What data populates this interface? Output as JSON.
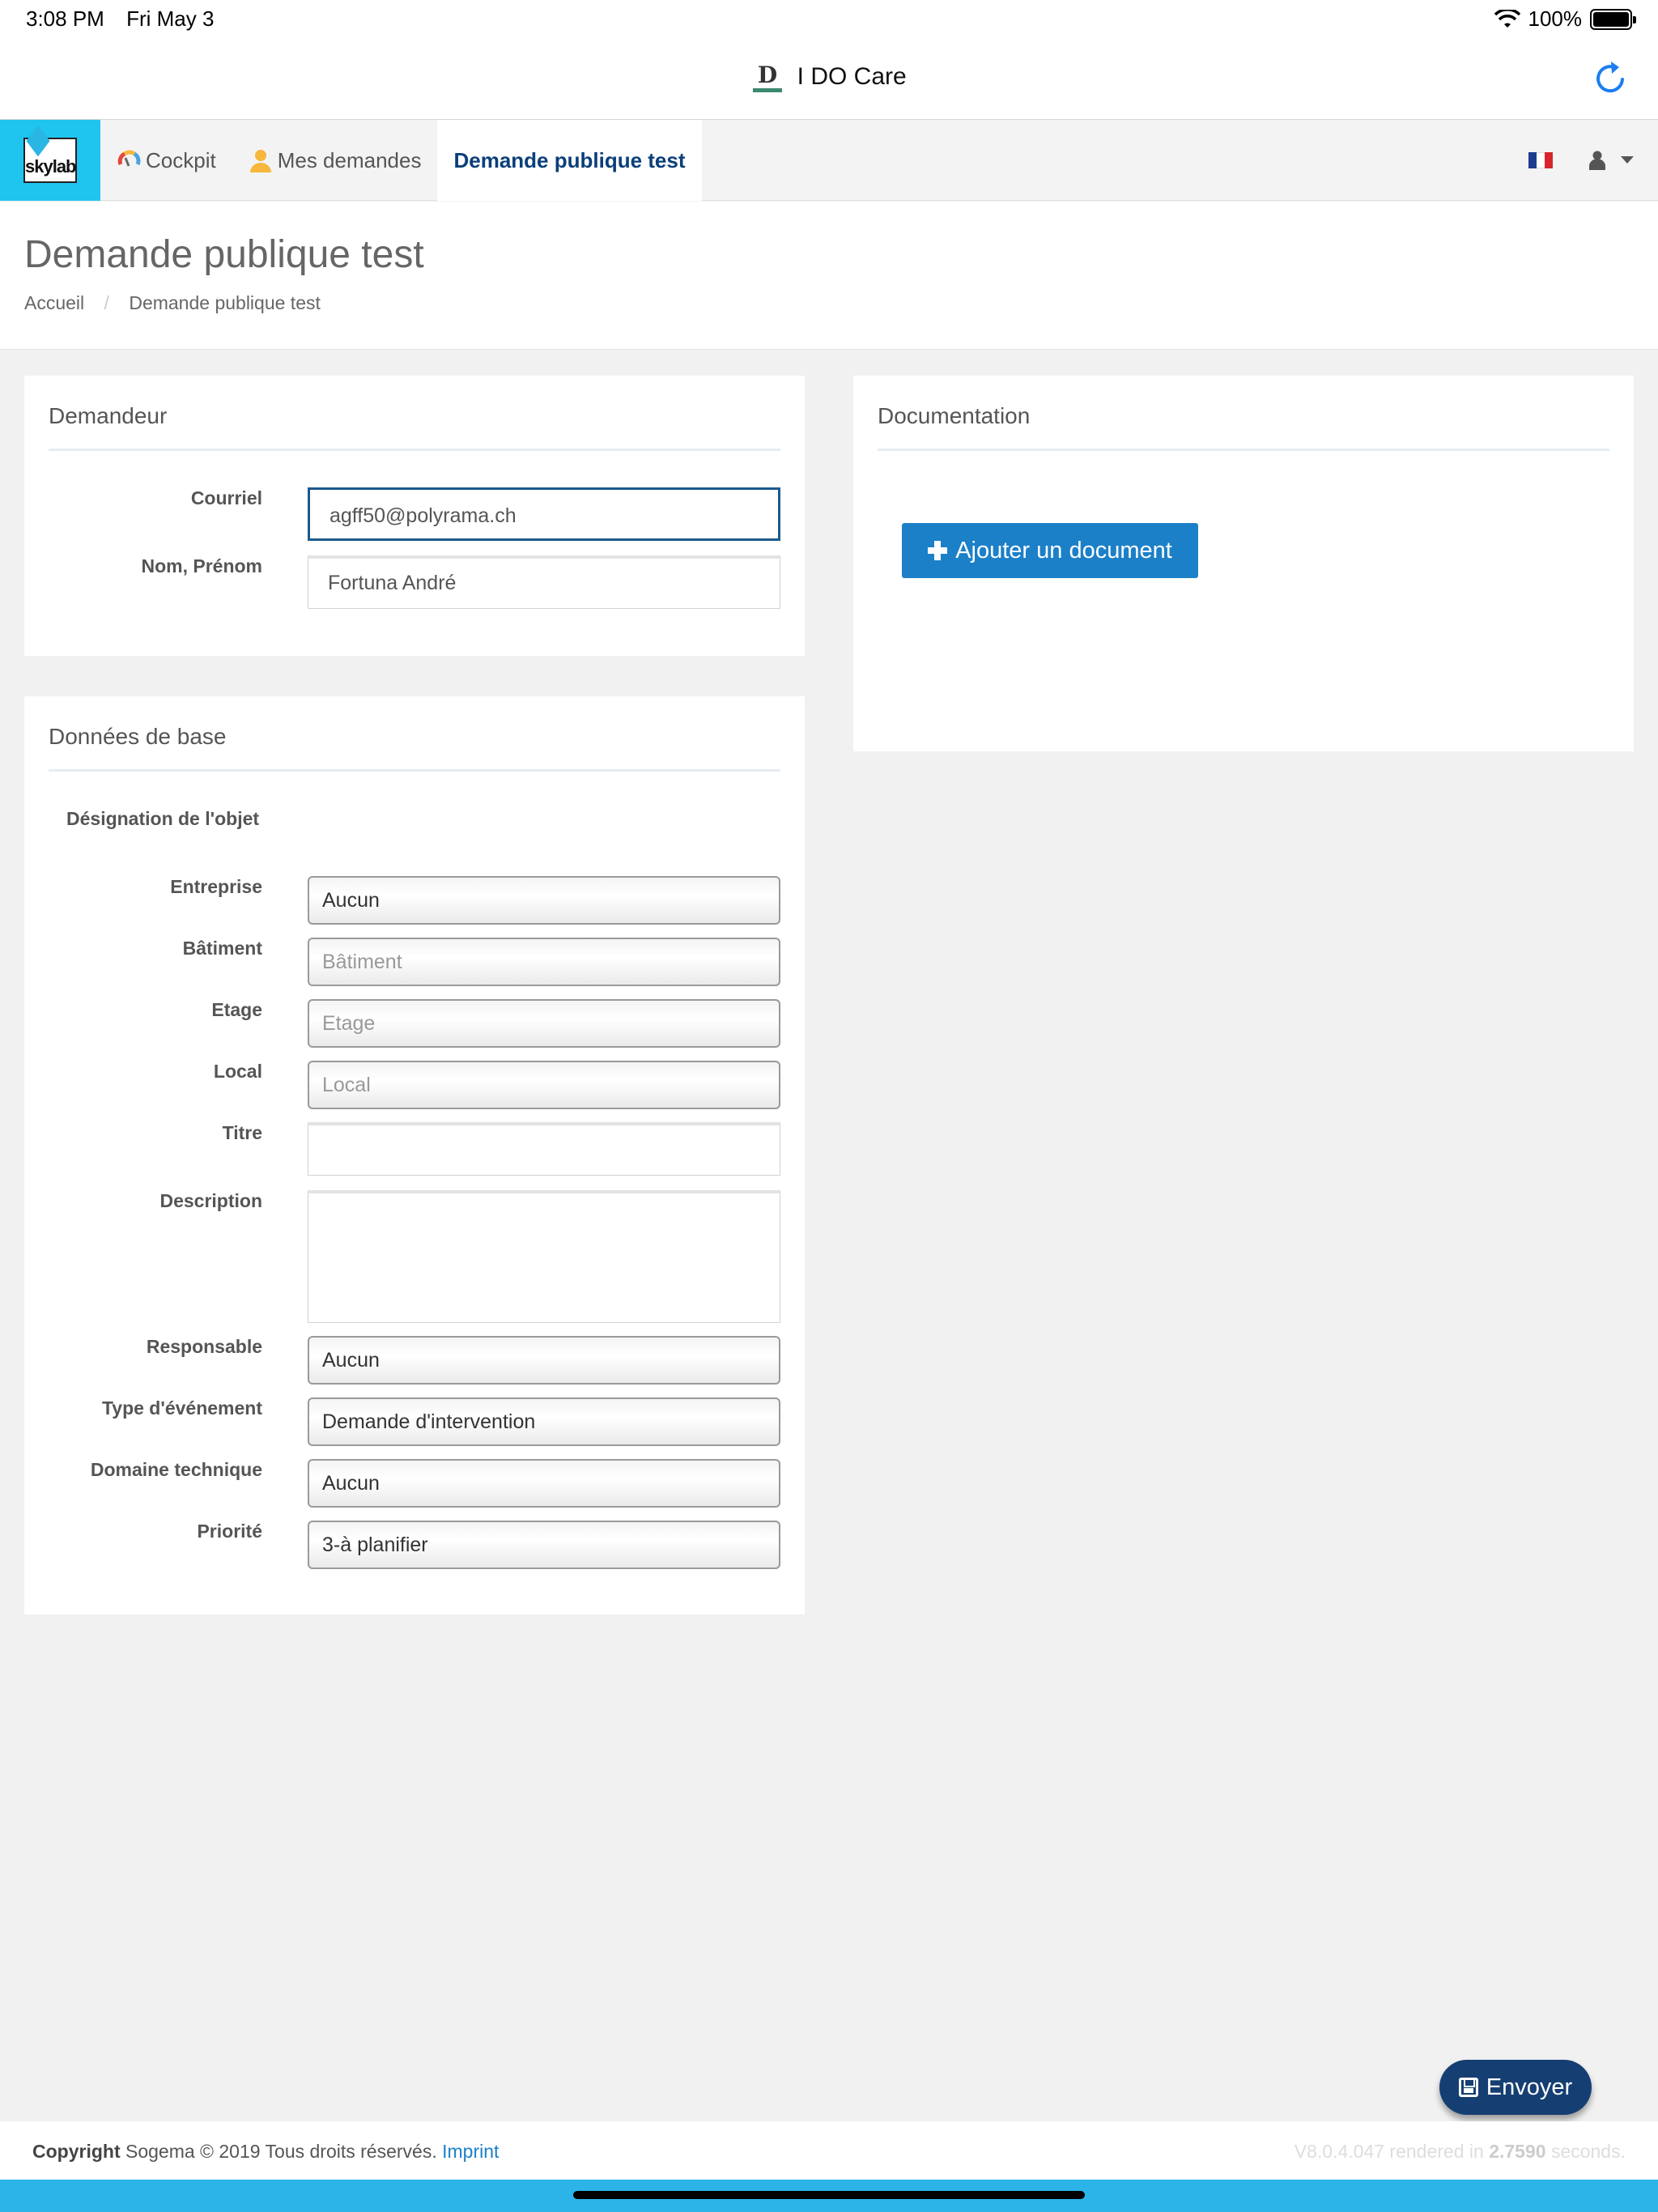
{
  "status_bar": {
    "time": "3:08 PM",
    "date": "Fri May 3",
    "battery": "100%"
  },
  "app": {
    "title": "I DO Care",
    "logo_letter": "D"
  },
  "nav": {
    "brand": "skylab",
    "items": [
      {
        "label": "Cockpit"
      },
      {
        "label": "Mes demandes"
      },
      {
        "label": "Demande publique test"
      }
    ]
  },
  "page": {
    "title": "Demande publique test",
    "breadcrumb": [
      "Accueil",
      "Demande publique test"
    ]
  },
  "demandeur": {
    "heading": "Demandeur",
    "email_label": "Courriel",
    "email_value": "agff50@polyrama.ch",
    "name_label": "Nom, Prénom",
    "name_value": "Fortuna André"
  },
  "documentation": {
    "heading": "Documentation",
    "add_button": "Ajouter un document"
  },
  "donnees": {
    "heading": "Données de base",
    "designation_label": "Désignation de l'objet",
    "entreprise_label": "Entreprise",
    "entreprise_value": "Aucun",
    "batiment_label": "Bâtiment",
    "batiment_placeholder": "Bâtiment",
    "etage_label": "Etage",
    "etage_placeholder": "Etage",
    "local_label": "Local",
    "local_placeholder": "Local",
    "titre_label": "Titre",
    "description_label": "Description",
    "responsable_label": "Responsable",
    "responsable_value": "Aucun",
    "type_label": "Type d'événement",
    "type_value": "Demande d'intervention",
    "domaine_label": "Domaine technique",
    "domaine_value": "Aucun",
    "priorite_label": "Priorité",
    "priorite_value": "3-à planifier"
  },
  "send_button": "Envoyer",
  "footer": {
    "copyright_label": "Copyright",
    "copyright_text": "Sogema © 2019 Tous droits réservés.",
    "imprint": "Imprint",
    "version_prefix": "V8.0.4.047 rendered in",
    "render_time": "2.7590",
    "version_suffix": "seconds."
  },
  "colors": {
    "brand_cyan": "#1fc4ef",
    "primary_blue": "#1c80c8",
    "send_navy": "#153f72",
    "nav_active": "#0b3f7a"
  }
}
